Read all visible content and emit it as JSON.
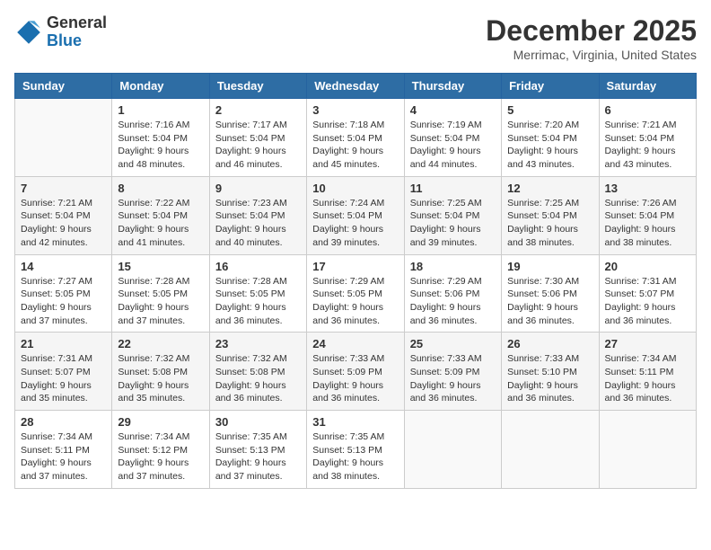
{
  "logo": {
    "general": "General",
    "blue": "Blue"
  },
  "header": {
    "month": "December 2025",
    "location": "Merrimac, Virginia, United States"
  },
  "weekdays": [
    "Sunday",
    "Monday",
    "Tuesday",
    "Wednesday",
    "Thursday",
    "Friday",
    "Saturday"
  ],
  "weeks": [
    [
      {
        "day": "",
        "empty": true
      },
      {
        "day": "1",
        "sunrise": "Sunrise: 7:16 AM",
        "sunset": "Sunset: 5:04 PM",
        "daylight": "Daylight: 9 hours and 48 minutes."
      },
      {
        "day": "2",
        "sunrise": "Sunrise: 7:17 AM",
        "sunset": "Sunset: 5:04 PM",
        "daylight": "Daylight: 9 hours and 46 minutes."
      },
      {
        "day": "3",
        "sunrise": "Sunrise: 7:18 AM",
        "sunset": "Sunset: 5:04 PM",
        "daylight": "Daylight: 9 hours and 45 minutes."
      },
      {
        "day": "4",
        "sunrise": "Sunrise: 7:19 AM",
        "sunset": "Sunset: 5:04 PM",
        "daylight": "Daylight: 9 hours and 44 minutes."
      },
      {
        "day": "5",
        "sunrise": "Sunrise: 7:20 AM",
        "sunset": "Sunset: 5:04 PM",
        "daylight": "Daylight: 9 hours and 43 minutes."
      },
      {
        "day": "6",
        "sunrise": "Sunrise: 7:21 AM",
        "sunset": "Sunset: 5:04 PM",
        "daylight": "Daylight: 9 hours and 43 minutes."
      }
    ],
    [
      {
        "day": "7",
        "sunrise": "Sunrise: 7:21 AM",
        "sunset": "Sunset: 5:04 PM",
        "daylight": "Daylight: 9 hours and 42 minutes."
      },
      {
        "day": "8",
        "sunrise": "Sunrise: 7:22 AM",
        "sunset": "Sunset: 5:04 PM",
        "daylight": "Daylight: 9 hours and 41 minutes."
      },
      {
        "day": "9",
        "sunrise": "Sunrise: 7:23 AM",
        "sunset": "Sunset: 5:04 PM",
        "daylight": "Daylight: 9 hours and 40 minutes."
      },
      {
        "day": "10",
        "sunrise": "Sunrise: 7:24 AM",
        "sunset": "Sunset: 5:04 PM",
        "daylight": "Daylight: 9 hours and 39 minutes."
      },
      {
        "day": "11",
        "sunrise": "Sunrise: 7:25 AM",
        "sunset": "Sunset: 5:04 PM",
        "daylight": "Daylight: 9 hours and 39 minutes."
      },
      {
        "day": "12",
        "sunrise": "Sunrise: 7:25 AM",
        "sunset": "Sunset: 5:04 PM",
        "daylight": "Daylight: 9 hours and 38 minutes."
      },
      {
        "day": "13",
        "sunrise": "Sunrise: 7:26 AM",
        "sunset": "Sunset: 5:04 PM",
        "daylight": "Daylight: 9 hours and 38 minutes."
      }
    ],
    [
      {
        "day": "14",
        "sunrise": "Sunrise: 7:27 AM",
        "sunset": "Sunset: 5:05 PM",
        "daylight": "Daylight: 9 hours and 37 minutes."
      },
      {
        "day": "15",
        "sunrise": "Sunrise: 7:28 AM",
        "sunset": "Sunset: 5:05 PM",
        "daylight": "Daylight: 9 hours and 37 minutes."
      },
      {
        "day": "16",
        "sunrise": "Sunrise: 7:28 AM",
        "sunset": "Sunset: 5:05 PM",
        "daylight": "Daylight: 9 hours and 36 minutes."
      },
      {
        "day": "17",
        "sunrise": "Sunrise: 7:29 AM",
        "sunset": "Sunset: 5:05 PM",
        "daylight": "Daylight: 9 hours and 36 minutes."
      },
      {
        "day": "18",
        "sunrise": "Sunrise: 7:29 AM",
        "sunset": "Sunset: 5:06 PM",
        "daylight": "Daylight: 9 hours and 36 minutes."
      },
      {
        "day": "19",
        "sunrise": "Sunrise: 7:30 AM",
        "sunset": "Sunset: 5:06 PM",
        "daylight": "Daylight: 9 hours and 36 minutes."
      },
      {
        "day": "20",
        "sunrise": "Sunrise: 7:31 AM",
        "sunset": "Sunset: 5:07 PM",
        "daylight": "Daylight: 9 hours and 36 minutes."
      }
    ],
    [
      {
        "day": "21",
        "sunrise": "Sunrise: 7:31 AM",
        "sunset": "Sunset: 5:07 PM",
        "daylight": "Daylight: 9 hours and 35 minutes."
      },
      {
        "day": "22",
        "sunrise": "Sunrise: 7:32 AM",
        "sunset": "Sunset: 5:08 PM",
        "daylight": "Daylight: 9 hours and 35 minutes."
      },
      {
        "day": "23",
        "sunrise": "Sunrise: 7:32 AM",
        "sunset": "Sunset: 5:08 PM",
        "daylight": "Daylight: 9 hours and 36 minutes."
      },
      {
        "day": "24",
        "sunrise": "Sunrise: 7:33 AM",
        "sunset": "Sunset: 5:09 PM",
        "daylight": "Daylight: 9 hours and 36 minutes."
      },
      {
        "day": "25",
        "sunrise": "Sunrise: 7:33 AM",
        "sunset": "Sunset: 5:09 PM",
        "daylight": "Daylight: 9 hours and 36 minutes."
      },
      {
        "day": "26",
        "sunrise": "Sunrise: 7:33 AM",
        "sunset": "Sunset: 5:10 PM",
        "daylight": "Daylight: 9 hours and 36 minutes."
      },
      {
        "day": "27",
        "sunrise": "Sunrise: 7:34 AM",
        "sunset": "Sunset: 5:11 PM",
        "daylight": "Daylight: 9 hours and 36 minutes."
      }
    ],
    [
      {
        "day": "28",
        "sunrise": "Sunrise: 7:34 AM",
        "sunset": "Sunset: 5:11 PM",
        "daylight": "Daylight: 9 hours and 37 minutes."
      },
      {
        "day": "29",
        "sunrise": "Sunrise: 7:34 AM",
        "sunset": "Sunset: 5:12 PM",
        "daylight": "Daylight: 9 hours and 37 minutes."
      },
      {
        "day": "30",
        "sunrise": "Sunrise: 7:35 AM",
        "sunset": "Sunset: 5:13 PM",
        "daylight": "Daylight: 9 hours and 37 minutes."
      },
      {
        "day": "31",
        "sunrise": "Sunrise: 7:35 AM",
        "sunset": "Sunset: 5:13 PM",
        "daylight": "Daylight: 9 hours and 38 minutes."
      },
      {
        "day": "",
        "empty": true
      },
      {
        "day": "",
        "empty": true
      },
      {
        "day": "",
        "empty": true
      }
    ]
  ]
}
